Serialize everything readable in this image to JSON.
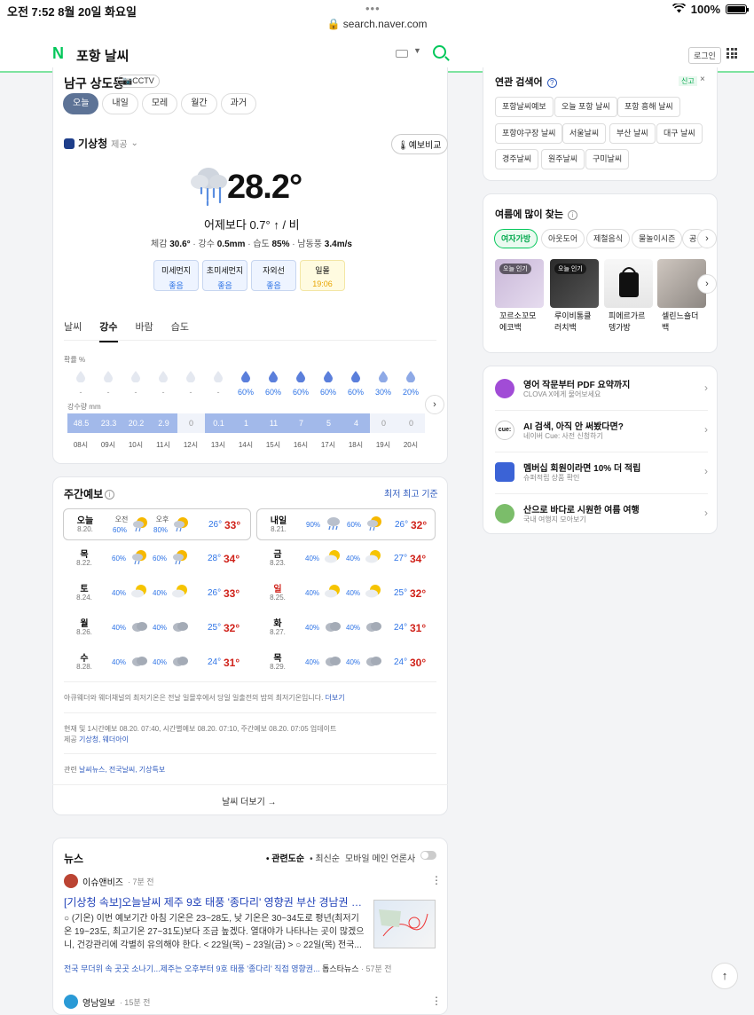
{
  "status": {
    "time": "오전 7:52",
    "date": "8월 20일 화요일",
    "battery": "100%",
    "battery_level": 1.0
  },
  "browser": {
    "url": "search.naver.com"
  },
  "header": {
    "logo": "N",
    "query": "포항 날씨",
    "login": "로그인"
  },
  "weather": {
    "location": "남구 상도동",
    "cctv": "CCTV",
    "day_tabs": [
      "오늘",
      "내일",
      "모레",
      "월간",
      "과거"
    ],
    "provider": "기상청",
    "provider_sub": "제공",
    "compare": "예보비교",
    "temp": "28.2°",
    "compare_line": "어제보다 0.7° ↑ / 비",
    "feel_label": "체감",
    "feel": "30.6°",
    "rain_label": "강수",
    "rain": "0.5mm",
    "hum_label": "습도",
    "hum": "85%",
    "wind_label": "남동풍",
    "wind": "3.4m/s",
    "dust": [
      {
        "label": "미세먼지",
        "value": "좋음"
      },
      {
        "label": "초미세먼지",
        "value": "좋음"
      },
      {
        "label": "자외선",
        "value": "좋음"
      },
      {
        "label": "일몰",
        "value": "19:06"
      }
    ],
    "sub_tabs": [
      "날씨",
      "강수",
      "바람",
      "습도"
    ],
    "prob_label": "확률 %",
    "probs": [
      "-",
      "-",
      "-",
      "-",
      "-",
      "-",
      "60%",
      "60%",
      "60%",
      "60%",
      "60%",
      "30%",
      "20%"
    ],
    "rain_label2": "강수량 mm",
    "rain_amounts": [
      "48.5",
      "23.3",
      "20.2",
      "2.9",
      "0",
      "0.1",
      "1",
      "11",
      "7",
      "5",
      "4",
      "0",
      "0"
    ],
    "hours": [
      "08시",
      "09시",
      "10시",
      "11시",
      "12시",
      "13시",
      "14시",
      "15시",
      "16시",
      "17시",
      "18시",
      "19시",
      "20시"
    ]
  },
  "weekly": {
    "title": "주간예보",
    "header_right": "최저  최고 기준",
    "days": [
      {
        "name": "오늘",
        "date": "8.20.",
        "am_label": "오전",
        "pm_label": "오후",
        "am_pop": "60%",
        "pm_pop": "80%",
        "min": "26°",
        "max": "33°"
      },
      {
        "name": "내일",
        "date": "8.21.",
        "am_pop": "90%",
        "pm_pop": "60%",
        "min": "26°",
        "max": "32°"
      },
      {
        "name": "목",
        "date": "8.22.",
        "am_pop": "60%",
        "pm_pop": "60%",
        "min": "28°",
        "max": "34°"
      },
      {
        "name": "금",
        "date": "8.23.",
        "am_pop": "40%",
        "pm_pop": "40%",
        "min": "27°",
        "max": "34°"
      },
      {
        "name": "토",
        "date": "8.24.",
        "am_pop": "40%",
        "pm_pop": "40%",
        "min": "26°",
        "max": "33°"
      },
      {
        "name": "일",
        "date": "8.25.",
        "am_pop": "40%",
        "pm_pop": "40%",
        "min": "25°",
        "max": "32°"
      },
      {
        "name": "월",
        "date": "8.26.",
        "am_pop": "40%",
        "pm_pop": "40%",
        "min": "25°",
        "max": "32°"
      },
      {
        "name": "화",
        "date": "8.27.",
        "am_pop": "40%",
        "pm_pop": "40%",
        "min": "24°",
        "max": "31°"
      },
      {
        "name": "수",
        "date": "8.28.",
        "am_pop": "40%",
        "pm_pop": "40%",
        "min": "24°",
        "max": "31°"
      },
      {
        "name": "목",
        "date": "8.29.",
        "am_pop": "40%",
        "pm_pop": "40%",
        "min": "24°",
        "max": "30°"
      }
    ],
    "note1": "아큐웨더와 웨더채널의 최저기온은 전날 일몰후에서 당일 일출전의 밤의 최저기온입니다.",
    "note1_link": "더보기",
    "note2": "현재 및 1시간예보 08.20. 07:40, 시간별예보 08.20. 07:10, 주간예보 08.20. 07:05 업데이트",
    "note3_prefix": "제공",
    "note3_links": "기상청, 웨더아이",
    "note4_prefix": "관련",
    "note4_links": "날씨뉴스, 전국날씨, 기상특보",
    "more": "날씨 더보기 →"
  },
  "news": {
    "title": "뉴스",
    "sort": [
      "• 관련도순",
      "• 최신순"
    ],
    "mobile_main": "모바일 메인 언론사",
    "press1": "이슈앤비즈",
    "time1": "· 7분 전",
    "headline": "[기상청 속보]오늘날씨 제주 9호 태풍 '종다리' 영향권 부산 경남권 호우특...",
    "body": "○ (기온) 이번 예보기간 아침 기온은 23~28도, 낮 기온은 30~34도로 평년(최저기온 19~23도, 최고기온 27~31도)보다 조금 높겠다. 열대야가 나타나는 곳이 많겠으니, 건강관리에 각별히 유의해야 한다. < 22일(목) ~ 23일(금) > ○ 22일(목) 전국...",
    "sub_link": "전국 무더위 속 곳곳 소나기...제주는 오후부터 9호 태풍 '종다리' 직접 영향권...",
    "sub_press": "톱스타뉴스",
    "sub_time": "· 57분 전",
    "press2": "영남일보",
    "time2": "· 15분 전"
  },
  "related": {
    "title": "연관 검색어",
    "report": "신고",
    "close": "×",
    "chips": [
      "포항날씨예보",
      "오늘 포항 날씨",
      "포항 흥해 날씨",
      "포항야구장 날씨",
      "서울날씨",
      "부산 날씨",
      "대구 날씨",
      "경주날씨",
      "원주날씨",
      "구미날씨"
    ]
  },
  "summer": {
    "title": "여름에 많이 찾는",
    "pills": [
      "여자가방",
      "아웃도어",
      "제철음식",
      "물놀이시즌",
      "공"
    ],
    "products": [
      {
        "badge": "오늘 인기",
        "name1": "꼬르소꼬모",
        "name2": "에코백"
      },
      {
        "badge": "오늘 인기",
        "name1": "루이비통클",
        "name2": "러치백"
      },
      {
        "badge": "",
        "name1": "피에르가르",
        "name2": "뎅가방"
      },
      {
        "badge": "",
        "name1": "셀린느숄더",
        "name2": "백"
      }
    ]
  },
  "promos": [
    {
      "title": "영어 작문부터 PDF 요약까지",
      "sub": "CLOVA X에게 물어보세요"
    },
    {
      "title": "AI 검색, 아직 안 써봤다면?",
      "sub": "네이버 Cue: 사전 신청하기"
    },
    {
      "title": "멤버십 회원이라면 10% 더 적립",
      "sub": "슈퍼적립 상품 확인"
    },
    {
      "title": "산으로 바다로 시원한 여름 여행",
      "sub": "국내 여행지 모아보기"
    }
  ],
  "top_button": "↑"
}
